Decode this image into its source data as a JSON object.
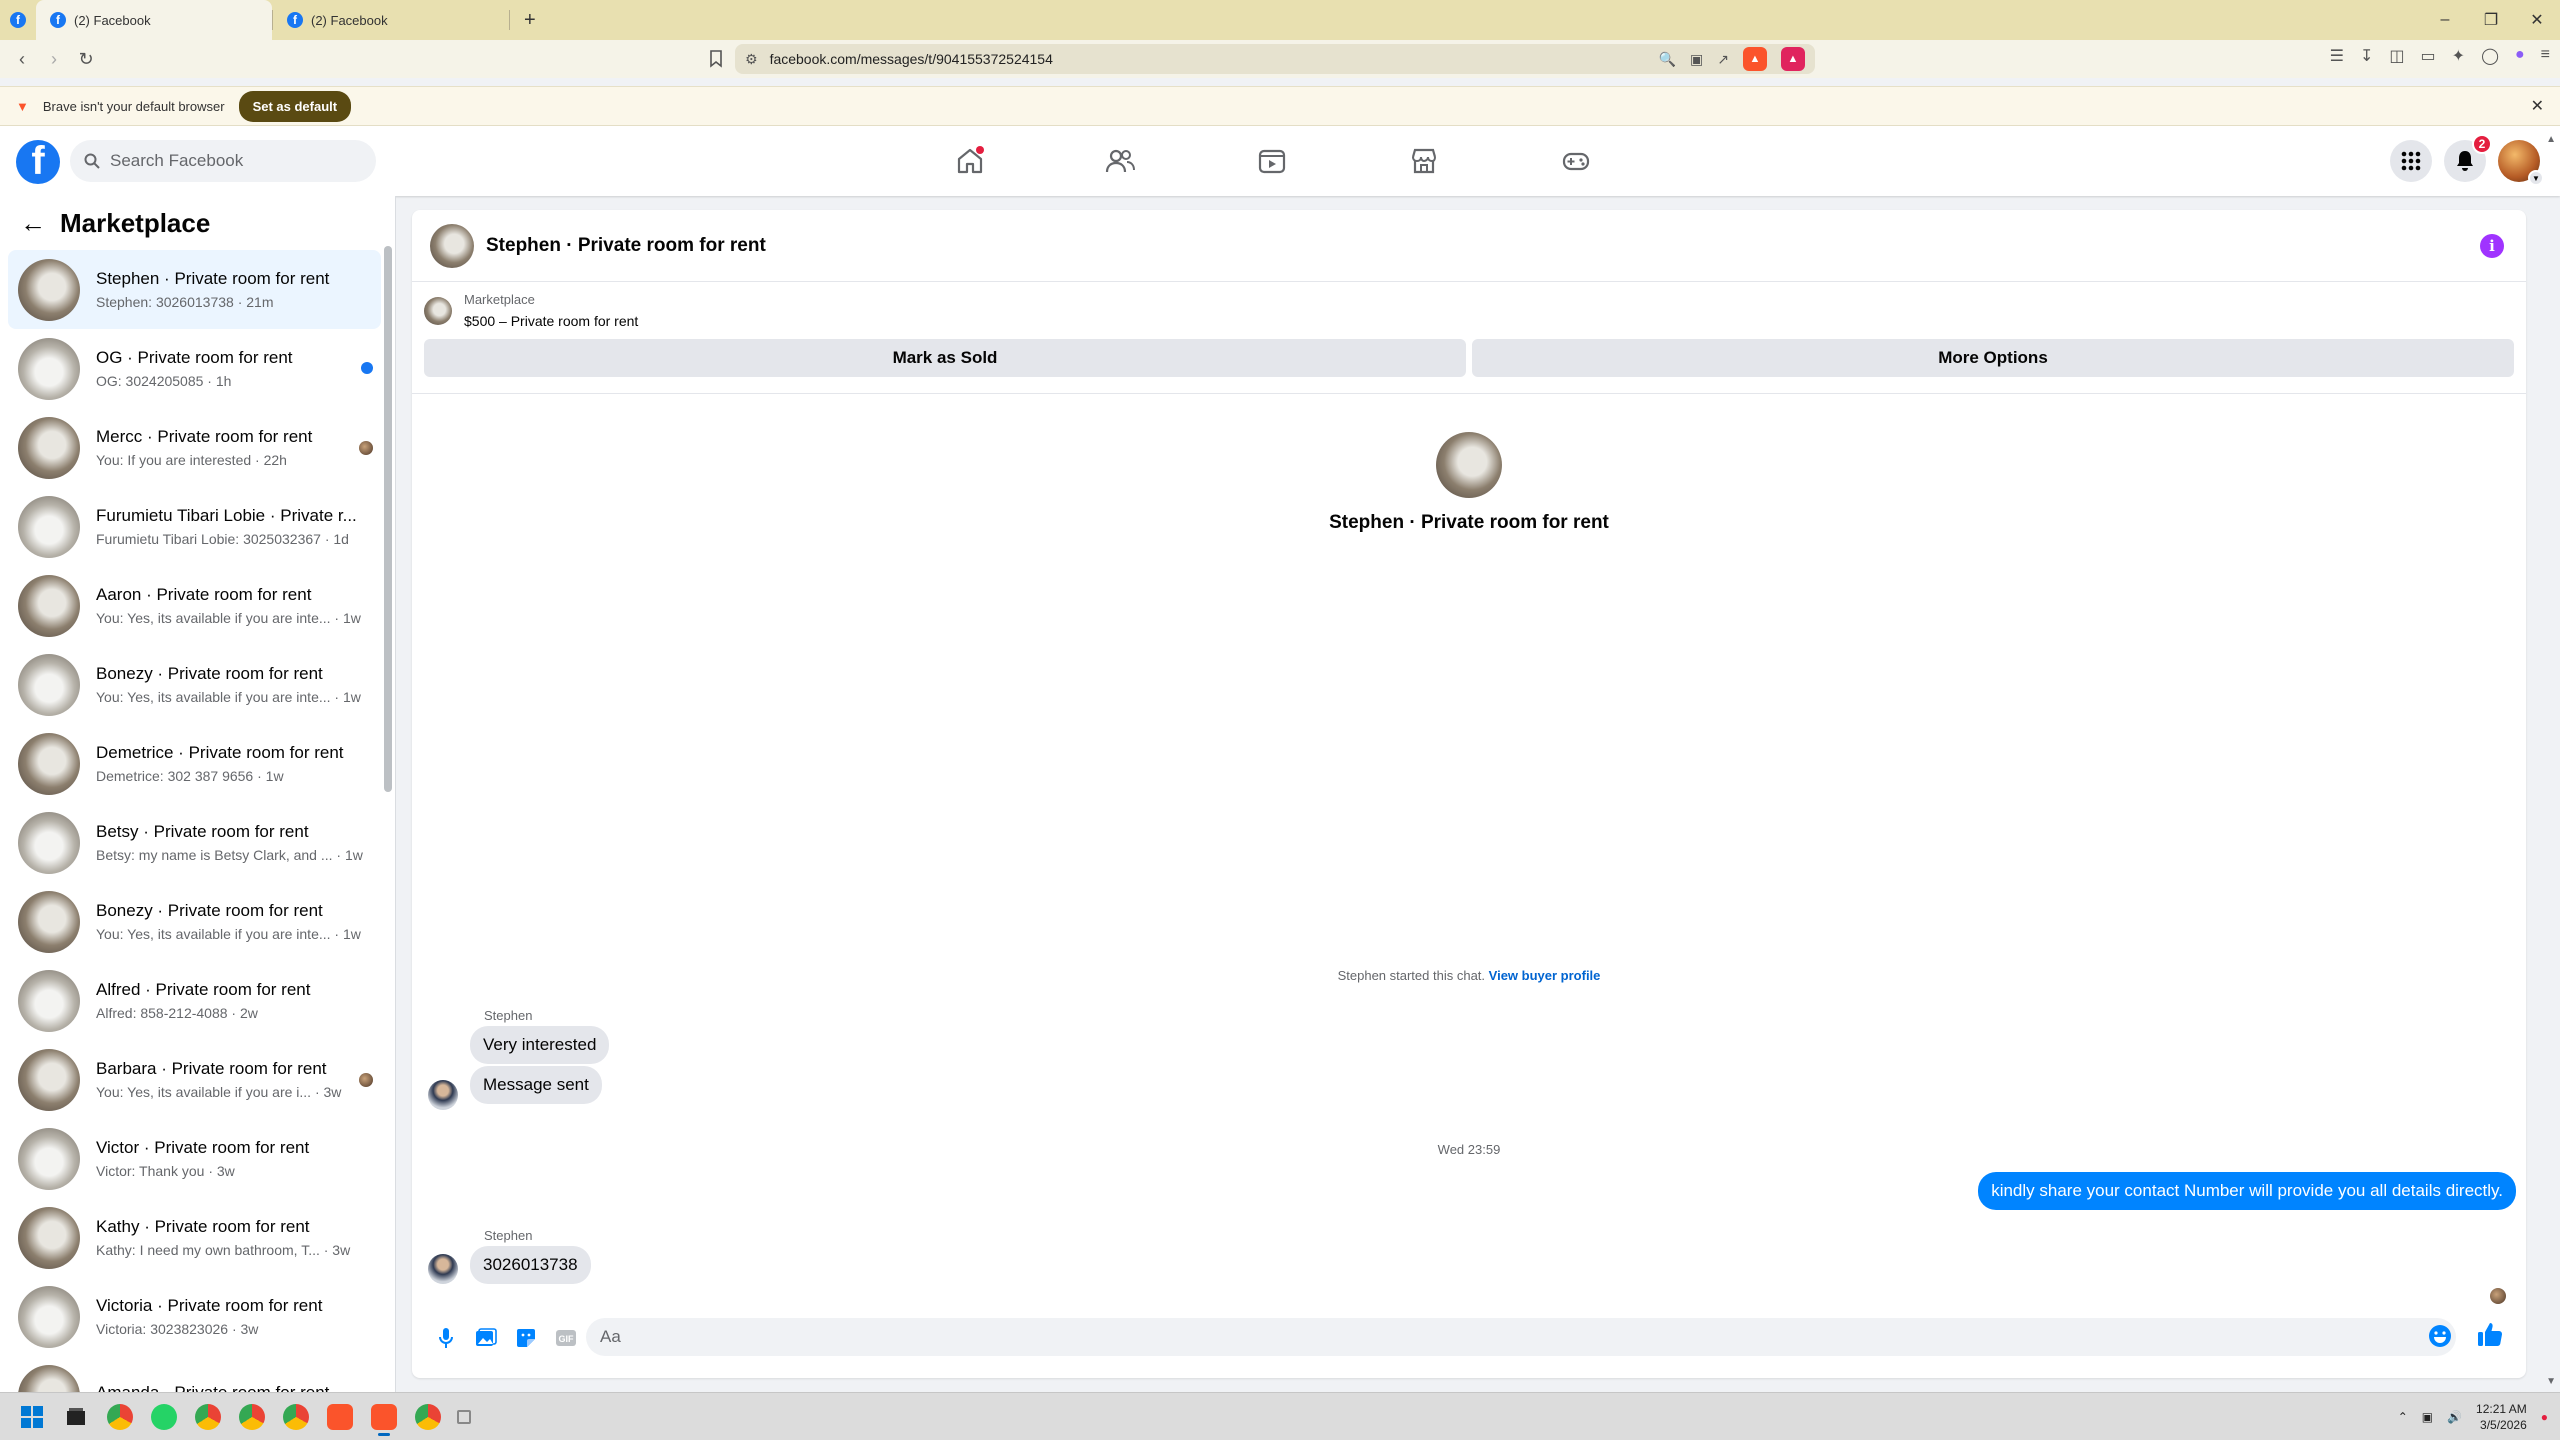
{
  "browser": {
    "tabs": [
      {
        "title": "(2) Facebook",
        "active": true
      },
      {
        "title": "(2) Facebook",
        "active": false
      }
    ],
    "url": "facebook.com/messages/t/904155372524154",
    "infobar_text": "Brave isn't your default browser",
    "infobar_button": "Set as default"
  },
  "fb": {
    "search_placeholder": "Search Facebook",
    "notification_count": "2"
  },
  "sidebar": {
    "title": "Marketplace",
    "conversations": [
      {
        "title": "Stephen · Private room for rent",
        "subtitle": "Stephen: 3026013738 · 21m",
        "selected": true,
        "indicator": "none"
      },
      {
        "title": "OG · Private room for rent",
        "subtitle": "OG: 3024205085 · 1h",
        "indicator": "unread"
      },
      {
        "title": "Mercc · Private room for rent",
        "subtitle": "You: If you are interested · 22h",
        "indicator": "seen"
      },
      {
        "title": "Furumietu Tibari Lobie · Private r...",
        "subtitle": "Furumietu Tibari Lobie: 3025032367 · 1d",
        "indicator": "none"
      },
      {
        "title": "Aaron · Private room for rent",
        "subtitle": "You: Yes, its available if you are inte... · 1w",
        "indicator": "none"
      },
      {
        "title": "Bonezy · Private room for rent",
        "subtitle": "You: Yes, its available if you are inte... · 1w",
        "indicator": "none"
      },
      {
        "title": "Demetrice · Private room for rent",
        "subtitle": "Demetrice: 302 387 9656 · 1w",
        "indicator": "none"
      },
      {
        "title": "Betsy · Private room for rent",
        "subtitle": "Betsy: my name is Betsy Clark, and ... · 1w",
        "indicator": "none"
      },
      {
        "title": "Bonezy · Private room for rent",
        "subtitle": "You: Yes, its available if you are inte... · 1w",
        "indicator": "none"
      },
      {
        "title": "Alfred · Private room for rent",
        "subtitle": "Alfred: 858-212-4088 · 2w",
        "indicator": "none"
      },
      {
        "title": "Barbara · Private room for rent",
        "subtitle": "You: Yes, its available if you are i... · 3w",
        "indicator": "seen"
      },
      {
        "title": "Victor · Private room for rent",
        "subtitle": "Victor: Thank you · 3w",
        "indicator": "none"
      },
      {
        "title": "Kathy · Private room for rent",
        "subtitle": "Kathy: I need my own bathroom, T... · 3w",
        "indicator": "none"
      },
      {
        "title": "Victoria · Private room for rent",
        "subtitle": "Victoria: 3023823026 · 3w",
        "indicator": "none"
      },
      {
        "title": "Amanda · Private room for rent",
        "subtitle": "",
        "indicator": "none"
      }
    ]
  },
  "chat": {
    "title": "Stephen · Private room for rent",
    "listing_source": "Marketplace",
    "listing_price": "$500 – Private room for rent",
    "mark_sold_label": "Mark as Sold",
    "more_options_label": "More Options",
    "intro_name": "Stephen · Private room for rent",
    "started_text": "Stephen started this chat.",
    "view_buyer_profile": "View buyer profile",
    "sender_name": "Stephen",
    "msg1": "Very interested",
    "msg2": "Message sent",
    "time_separator": "Wed 23:59",
    "msg_out": "kindly share your contact Number will provide you all details directly.",
    "sender_name2": "Stephen",
    "msg3": "3026013738",
    "input_placeholder": "Aa"
  },
  "taskbar": {
    "time": "12:21 AM",
    "date": "3/5/2026"
  },
  "colors": {
    "fb_blue": "#1877f2",
    "messenger_blue": "#0084ff",
    "info_purple": "#a033ff",
    "unread_blue": "#1877f2"
  }
}
